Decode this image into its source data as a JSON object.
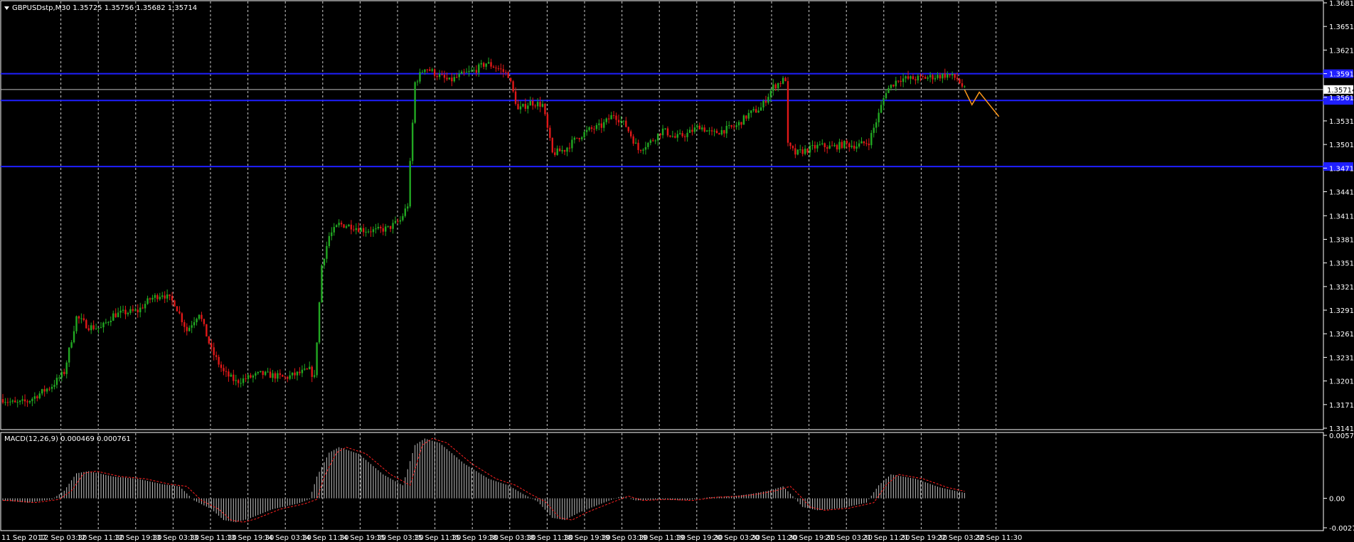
{
  "colors": {
    "background": "#000000",
    "grid": "#ffffff",
    "bull_candle": "#22a822",
    "bear_candle": "#e01818",
    "level_line": "#1f1fff",
    "price_line": "#c0c0c0",
    "forecast": "#ff9a1a",
    "macd_hist": "#c0c0c0",
    "macd_signal": "#ff2020",
    "axis_text": "#ffffff"
  },
  "header": {
    "menu_icon": "triangle-down-icon",
    "symbol_text": "GBPUSDstp,M30  1.35725 1.35756 1.35682 1.35714"
  },
  "macd_header": {
    "text": "MACD(12,26,9) 0.000469 0.000761"
  },
  "price_axis": {
    "ticks": [
      "1.36815",
      "1.36515",
      "1.36215",
      "1.35915",
      "1.35615",
      "1.35315",
      "1.35015",
      "1.34715",
      "1.34415",
      "1.34110",
      "1.33810",
      "1.33510",
      "1.33210",
      "1.32910",
      "1.32610",
      "1.32310",
      "1.32010",
      "1.31710",
      "1.31410"
    ],
    "current_price": "1.35714"
  },
  "macd_axis": {
    "ticks": [
      "0.005795",
      "0.00",
      "-0.002711"
    ]
  },
  "time_axis": {
    "labels": [
      "11 Sep 2017",
      "12 Sep 03:30",
      "12 Sep 11:30",
      "12 Sep 19:30",
      "13 Sep 03:30",
      "13 Sep 11:30",
      "13 Sep 19:30",
      "14 Sep 03:30",
      "14 Sep 11:30",
      "14 Sep 19:30",
      "15 Sep 03:30",
      "15 Sep 11:30",
      "15 Sep 19:30",
      "18 Sep 03:30",
      "18 Sep 11:30",
      "18 Sep 19:30",
      "19 Sep 03:30",
      "19 Sep 11:30",
      "19 Sep 19:30",
      "20 Sep 03:30",
      "20 Sep 11:30",
      "20 Sep 19:30",
      "21 Sep 03:30",
      "21 Sep 11:30",
      "21 Sep 19:30",
      "22 Sep 03:30",
      "22 Sep 11:30"
    ]
  },
  "chart_data": {
    "type": "candlestick",
    "symbol": "GBPUSDstp",
    "timeframe": "M30",
    "ylim": [
      1.3141,
      1.36815
    ],
    "grid": true,
    "horizontal_levels": [
      1.35915,
      1.35575,
      1.34735
    ],
    "current_price": 1.35714,
    "price_path": [
      [
        0,
        1.3178
      ],
      [
        5,
        1.3172
      ],
      [
        10,
        1.3175
      ],
      [
        15,
        1.3185
      ],
      [
        20,
        1.3195
      ],
      [
        25,
        1.3212
      ],
      [
        30,
        1.3282
      ],
      [
        35,
        1.327
      ],
      [
        40,
        1.3268
      ],
      [
        45,
        1.3285
      ],
      [
        50,
        1.3288
      ],
      [
        55,
        1.329
      ],
      [
        60,
        1.3305
      ],
      [
        65,
        1.3312
      ],
      [
        70,
        1.33
      ],
      [
        75,
        1.3265
      ],
      [
        80,
        1.3288
      ],
      [
        85,
        1.324
      ],
      [
        90,
        1.3212
      ],
      [
        95,
        1.32
      ],
      [
        100,
        1.3205
      ],
      [
        105,
        1.321
      ],
      [
        110,
        1.3208
      ],
      [
        115,
        1.3205
      ],
      [
        120,
        1.321
      ],
      [
        125,
        1.3215
      ],
      [
        127,
        1.3205
      ],
      [
        130,
        1.3348
      ],
      [
        133,
        1.3385
      ],
      [
        137,
        1.34
      ],
      [
        142,
        1.3398
      ],
      [
        147,
        1.3393
      ],
      [
        152,
        1.3392
      ],
      [
        157,
        1.3395
      ],
      [
        162,
        1.3405
      ],
      [
        165,
        1.3425
      ],
      [
        168,
        1.358
      ],
      [
        172,
        1.36
      ],
      [
        177,
        1.359
      ],
      [
        182,
        1.3582
      ],
      [
        187,
        1.359
      ],
      [
        192,
        1.3595
      ],
      [
        197,
        1.3605
      ],
      [
        202,
        1.3598
      ],
      [
        206,
        1.359
      ],
      [
        210,
        1.3545
      ],
      [
        215,
        1.3555
      ],
      [
        220,
        1.3552
      ],
      [
        224,
        1.349
      ],
      [
        229,
        1.3495
      ],
      [
        234,
        1.351
      ],
      [
        239,
        1.352
      ],
      [
        244,
        1.3525
      ],
      [
        249,
        1.354
      ],
      [
        254,
        1.3525
      ],
      [
        259,
        1.3495
      ],
      [
        264,
        1.3505
      ],
      [
        269,
        1.352
      ],
      [
        274,
        1.351
      ],
      [
        279,
        1.3515
      ],
      [
        284,
        1.3525
      ],
      [
        289,
        1.3515
      ],
      [
        294,
        1.352
      ],
      [
        299,
        1.3525
      ],
      [
        304,
        1.354
      ],
      [
        309,
        1.3548
      ],
      [
        314,
        1.3575
      ],
      [
        319,
        1.3585
      ],
      [
        320,
        1.35
      ],
      [
        323,
        1.349
      ],
      [
        328,
        1.3495
      ],
      [
        333,
        1.35
      ],
      [
        338,
        1.3498
      ],
      [
        343,
        1.3502
      ],
      [
        348,
        1.35
      ],
      [
        353,
        1.3505
      ],
      [
        357,
        1.354
      ],
      [
        360,
        1.357
      ],
      [
        365,
        1.3585
      ],
      [
        370,
        1.3585
      ],
      [
        375,
        1.3586
      ],
      [
        380,
        1.3588
      ],
      [
        385,
        1.359
      ],
      [
        389,
        1.3585
      ],
      [
        392,
        1.3571
      ]
    ],
    "forecast": [
      [
        392,
        1.3571
      ],
      [
        395,
        1.3552
      ],
      [
        398,
        1.3568
      ],
      [
        406,
        1.3537
      ]
    ],
    "macd": {
      "params": "12,26,9",
      "main": 0.000469,
      "signal": 0.000761,
      "ylim": [
        -0.002711,
        0.005795
      ],
      "path": [
        [
          0,
          -0.0002
        ],
        [
          10,
          -0.0004
        ],
        [
          20,
          -0.0001
        ],
        [
          25,
          0.0007
        ],
        [
          30,
          0.0023
        ],
        [
          35,
          0.0025
        ],
        [
          45,
          0.002
        ],
        [
          55,
          0.0018
        ],
        [
          65,
          0.0013
        ],
        [
          72,
          0.0011
        ],
        [
          78,
          -0.0002
        ],
        [
          85,
          -0.001
        ],
        [
          90,
          -0.002
        ],
        [
          95,
          -0.0022
        ],
        [
          100,
          -0.0019
        ],
        [
          110,
          -0.001
        ],
        [
          120,
          -0.0005
        ],
        [
          125,
          -0.0001
        ],
        [
          128,
          0.002
        ],
        [
          133,
          0.0042
        ],
        [
          137,
          0.0047
        ],
        [
          145,
          0.0041
        ],
        [
          155,
          0.0022
        ],
        [
          163,
          0.0012
        ],
        [
          168,
          0.0049
        ],
        [
          172,
          0.0055
        ],
        [
          178,
          0.0051
        ],
        [
          188,
          0.0032
        ],
        [
          198,
          0.0018
        ],
        [
          206,
          0.0012
        ],
        [
          212,
          0.0004
        ],
        [
          218,
          -0.0003
        ],
        [
          224,
          -0.0018
        ],
        [
          229,
          -0.002
        ],
        [
          235,
          -0.0013
        ],
        [
          245,
          -0.0004
        ],
        [
          252,
          0.0002
        ],
        [
          258,
          -0.0002
        ],
        [
          268,
          -0.0001
        ],
        [
          278,
          -0.0002
        ],
        [
          288,
          0.0001
        ],
        [
          298,
          0.0002
        ],
        [
          305,
          0.0004
        ],
        [
          312,
          0.0007
        ],
        [
          318,
          0.0011
        ],
        [
          322,
          0.0002
        ],
        [
          326,
          -0.0008
        ],
        [
          332,
          -0.0011
        ],
        [
          342,
          -0.0009
        ],
        [
          352,
          -0.0004
        ],
        [
          357,
          0.0012
        ],
        [
          362,
          0.0022
        ],
        [
          372,
          0.0018
        ],
        [
          382,
          0.001
        ],
        [
          392,
          0.0005
        ]
      ],
      "signal_offset": 3
    }
  }
}
